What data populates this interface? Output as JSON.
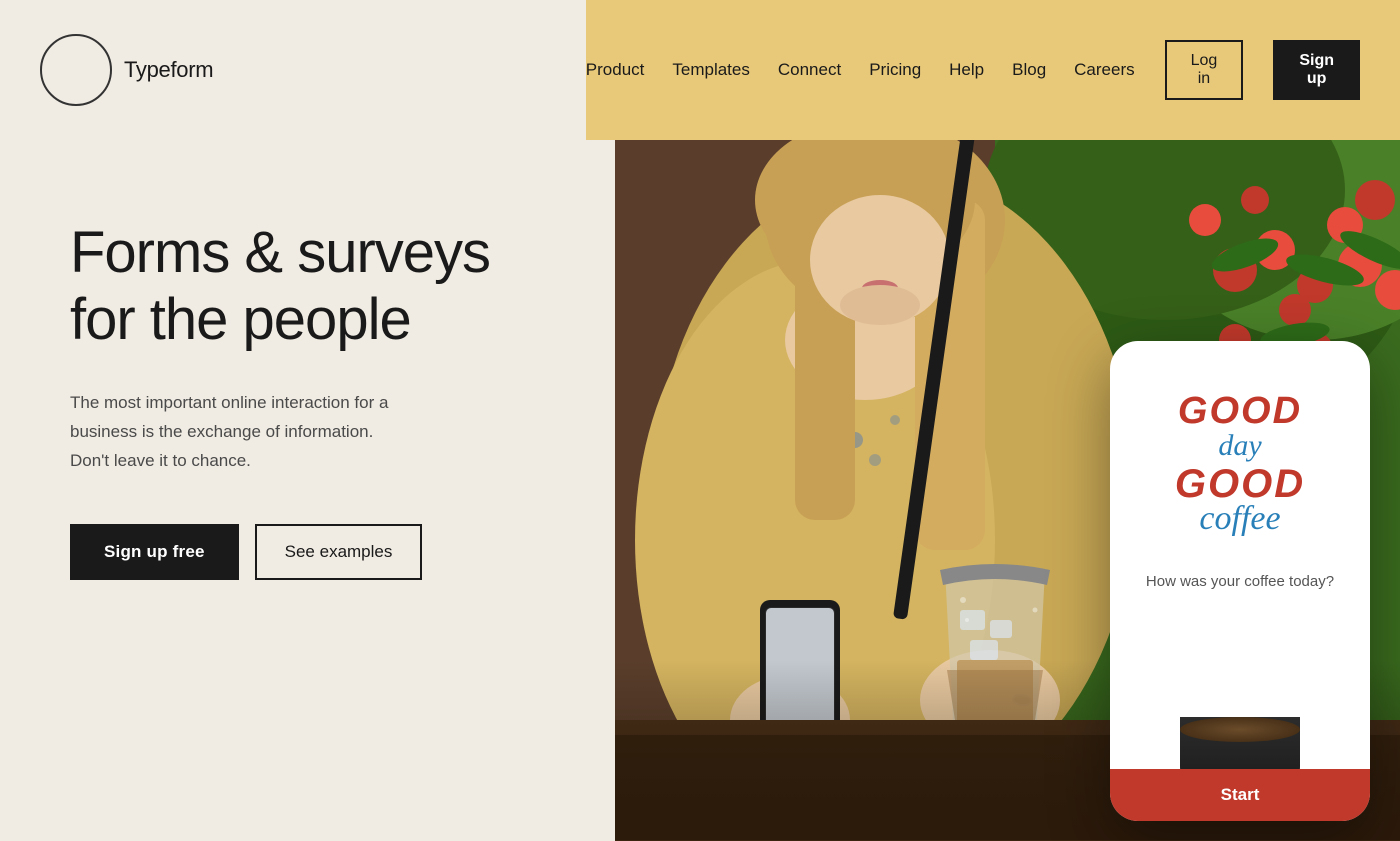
{
  "brand": {
    "name": "Typeform",
    "logo_alt": "Typeform logo"
  },
  "nav": {
    "items": [
      {
        "label": "Product",
        "href": "#"
      },
      {
        "label": "Templates",
        "href": "#"
      },
      {
        "label": "Connect",
        "href": "#"
      },
      {
        "label": "Pricing",
        "href": "#"
      },
      {
        "label": "Help",
        "href": "#"
      },
      {
        "label": "Blog",
        "href": "#"
      },
      {
        "label": "Careers",
        "href": "#"
      }
    ],
    "login_label": "Log in",
    "signup_label": "Sign up"
  },
  "hero": {
    "title": "Forms & surveys\nfor the people",
    "subtitle": "The most important online interaction for a business is the exchange of information. Don't leave it to chance.",
    "cta_primary": "Sign up free",
    "cta_secondary": "See examples"
  },
  "phone_mockup": {
    "brand_line1": "GOOD",
    "brand_line2": "day",
    "brand_line3": "GOOD",
    "brand_line4": "coffee",
    "question": "How was your coffee today?",
    "start_button": "Start"
  },
  "colors": {
    "bg_light": "#f0ebe3",
    "bg_yellow": "#e8c97a",
    "text_dark": "#1a1a1a",
    "red_accent": "#c0392b",
    "blue_accent": "#2980b9"
  }
}
